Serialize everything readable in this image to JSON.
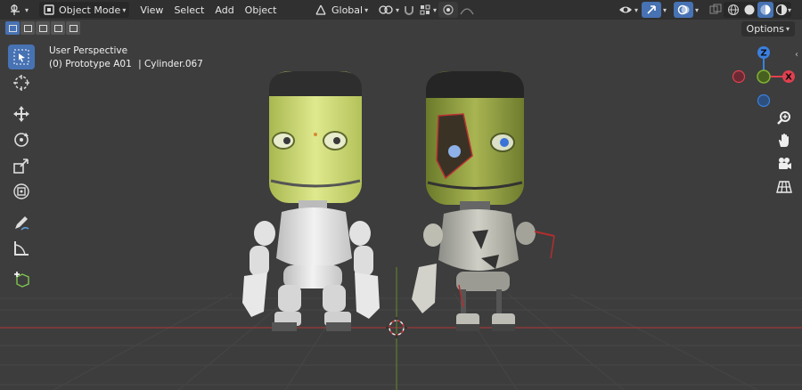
{
  "header": {
    "mode_label": "Object Mode",
    "menus": [
      "View",
      "Select",
      "Add",
      "Object"
    ],
    "orientation_label": "Global"
  },
  "toolbar_row": {
    "options_label": "Options"
  },
  "viewport": {
    "perspective_label": "User Perspective",
    "object_info": "(0) Prototype A01",
    "mesh_info": "| Cylinder.067"
  },
  "gizmo": {
    "z_label": "Z",
    "x_label": "X"
  },
  "colors": {
    "header_bg": "#303030",
    "viewport_bg": "#3d3d3d",
    "accent_blue": "#4772b3",
    "axis_red": "#e0404f",
    "axis_green": "#7fb432",
    "axis_blue": "#3b80e0"
  },
  "icons": {
    "editor_type": "viewport-icon",
    "mode": "object-mode-icon",
    "snap": "magnet-icon",
    "transform_pivot": "pivot-icon",
    "proportional": "proportional-edit-icon",
    "visibility": "eye-icon",
    "gizmo": "gizmo-icon",
    "overlays": "overlays-icon",
    "xray": "xray-icon",
    "shading": [
      "wireframe-icon",
      "solid-icon",
      "material-icon",
      "rendered-icon"
    ],
    "tools": [
      "select-box-icon",
      "cursor-icon",
      "move-icon",
      "rotate-icon",
      "scale-icon",
      "transform-icon",
      "annotate-icon",
      "measure-icon",
      "add-cube-icon"
    ],
    "nav": [
      "zoom-icon",
      "hand-icon",
      "camera-icon",
      "grid-icon"
    ]
  }
}
